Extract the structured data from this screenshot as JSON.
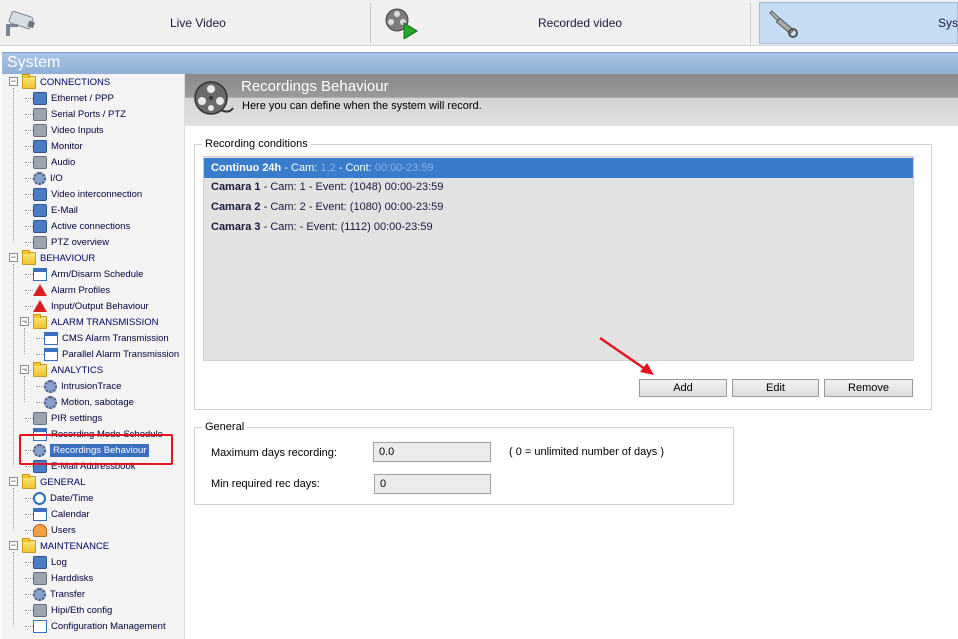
{
  "topnav": {
    "tabs": [
      {
        "label": "Live Video",
        "icon": "camera-icon"
      },
      {
        "label": "Recorded video",
        "icon": "film-reel-play-icon"
      },
      {
        "label": "Sys",
        "icon": "tools-icon",
        "active": true
      }
    ]
  },
  "system_bar": {
    "title": "System"
  },
  "sidebar": {
    "connections": {
      "label": "CONNECTIONS",
      "items": [
        "Ethernet / PPP",
        "Serial Ports / PTZ",
        "Video Inputs",
        "Monitor",
        "Audio",
        "I/O",
        "Video interconnection",
        "E-Mail",
        "Active connections",
        "PTZ overview"
      ]
    },
    "behaviour": {
      "label": "BEHAVIOUR",
      "items": [
        "Arm/Disarm Schedule",
        "Alarm Profiles",
        "Input/Output Behaviour"
      ],
      "alarm_transmission": {
        "label": "ALARM TRANSMISSION",
        "items": [
          "CMS Alarm Transmission",
          "Parallel Alarm Transmission"
        ]
      },
      "analytics": {
        "label": "ANALYTICS",
        "items": [
          "IntrusionTrace",
          "Motion, sabotage"
        ]
      },
      "items_after": [
        "PIR settings",
        "Recording Mode Schedule",
        "Recordings Behaviour",
        "E-Mail Addressbook"
      ],
      "selected": "Recordings Behaviour"
    },
    "general": {
      "label": "GENERAL",
      "items": [
        "Date/Time",
        "Calendar",
        "Users"
      ]
    },
    "maintenance": {
      "label": "MAINTENANCE",
      "items": [
        "Log",
        "Harddisks",
        "Transfer",
        "Hipi/Eth config",
        "Configuration Management"
      ]
    }
  },
  "header": {
    "title": "Recordings Behaviour",
    "subtitle": "Here you can define when the system will record."
  },
  "recording_conditions": {
    "legend": "Recording conditions",
    "rows": [
      {
        "name": "Continuo 24h",
        "rest": " - Cam: ",
        "faint1": "1,2",
        "rest2": "  - Cont: ",
        "faint2": "00:00-23:59",
        "selected": true
      },
      {
        "name": "Camara 1",
        "rest": " - Cam: 1 - Event:  (1048) 00:00-23:59"
      },
      {
        "name": "Camara 2",
        "rest": " - Cam: 2 - Event:  (1080) 00:00-23:59"
      },
      {
        "name": "Camara 3",
        "rest": " - Cam:   - Event:  (1112) 00:00-23:59"
      }
    ],
    "buttons": {
      "add": "Add",
      "edit": "Edit",
      "remove": "Remove"
    }
  },
  "general_settings": {
    "legend": "General",
    "max_days_label": "Maximum days recording:",
    "max_days_value": "0.0",
    "max_days_hint": "( 0 = unlimited number of days )",
    "min_days_label": "Min required rec days:",
    "min_days_value": "0"
  },
  "colors": {
    "selection": "#3a7ccc",
    "highlight_box": "#e3141d",
    "arrow": "#e3141d"
  }
}
